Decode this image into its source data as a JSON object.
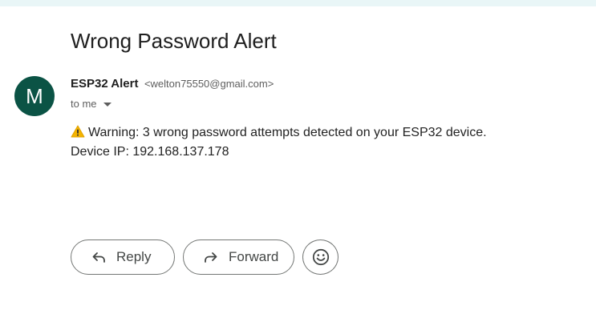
{
  "email": {
    "subject": "Wrong Password Alert",
    "sender": {
      "avatar_letter": "M",
      "avatar_color": "#0b5345",
      "name": "ESP32 Alert",
      "email": "<welton75550@gmail.com>"
    },
    "recipient": "to me",
    "body": {
      "warning_icon": "warning-icon",
      "line1": "Warning: 3 wrong password attempts detected on your ESP32 device.",
      "line2": "Device IP: 192.168.137.178"
    }
  },
  "actions": {
    "reply_label": "Reply",
    "reply_icon": "reply-icon",
    "forward_label": "Forward",
    "forward_icon": "forward-icon",
    "emoji_icon": "emoji-icon"
  },
  "colors": {
    "top_strip": "#e9f6f7",
    "button_border": "#747775"
  }
}
